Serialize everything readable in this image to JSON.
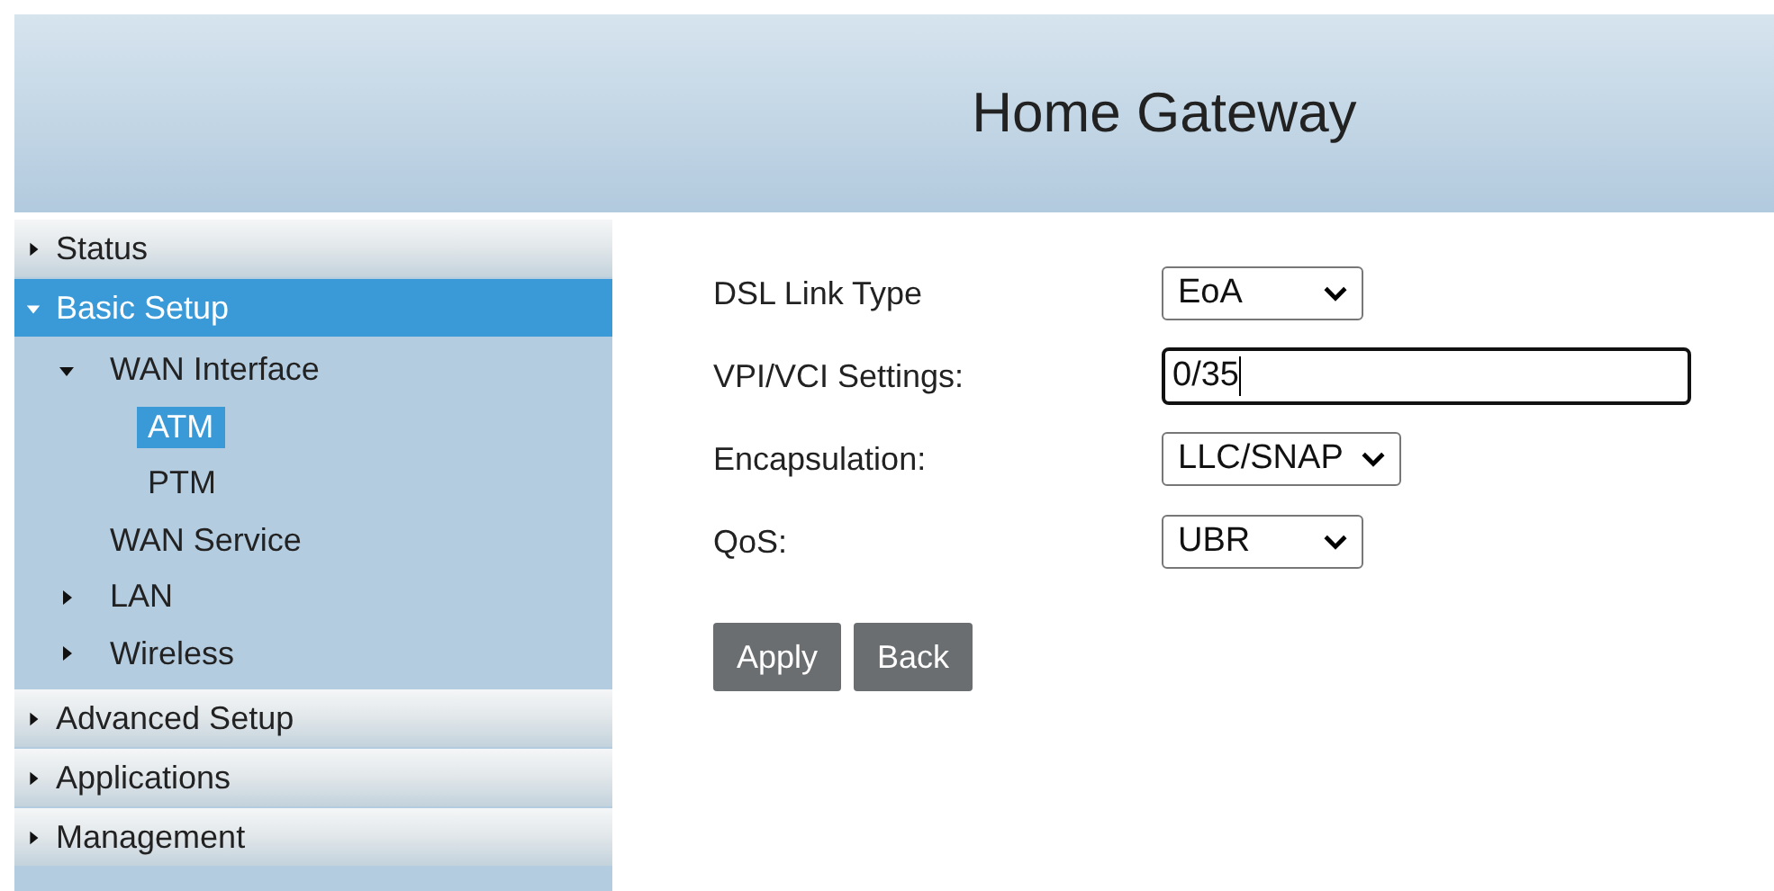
{
  "header": {
    "title": "Home Gateway"
  },
  "sidebar": {
    "items": [
      {
        "label": "Status",
        "expanded": false,
        "selected": false
      },
      {
        "label": "Basic Setup",
        "expanded": true,
        "selected": true,
        "children": [
          {
            "label": "WAN Interface",
            "expanded": true,
            "selected": false,
            "children": [
              {
                "label": "ATM",
                "selected": true
              },
              {
                "label": "PTM",
                "selected": false
              }
            ]
          },
          {
            "label": "WAN Service",
            "selected": false
          },
          {
            "label": "LAN",
            "expanded": false,
            "selected": false
          },
          {
            "label": "Wireless",
            "expanded": false,
            "selected": false
          }
        ]
      },
      {
        "label": "Advanced Setup",
        "expanded": false,
        "selected": false
      },
      {
        "label": "Applications",
        "expanded": false,
        "selected": false
      },
      {
        "label": "Management",
        "expanded": false,
        "selected": false
      }
    ]
  },
  "form": {
    "fields": [
      {
        "label": "DSL Link Type",
        "kind": "select",
        "value": "EoA"
      },
      {
        "label": "VPI/VCI Settings:",
        "kind": "text",
        "value": "0/35"
      },
      {
        "label": "Encapsulation:",
        "kind": "select",
        "value": "LLC/SNAP"
      },
      {
        "label": "QoS:",
        "kind": "select",
        "value": "UBR"
      }
    ],
    "buttons": [
      "Apply",
      "Back"
    ]
  }
}
